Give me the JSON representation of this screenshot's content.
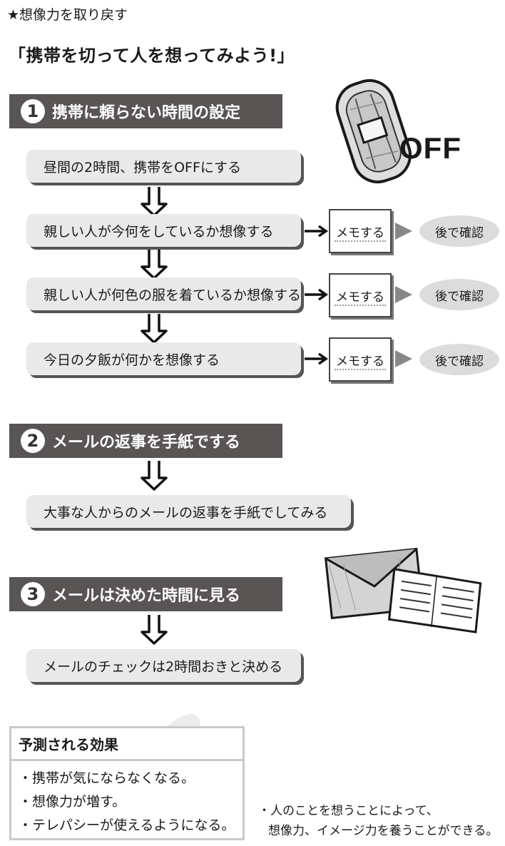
{
  "header": "★想像力を取り戻す",
  "title": "「携帯を切って人を想ってみよう!」",
  "phone_off_label": "OFF",
  "sections": [
    {
      "number": "1",
      "label": "携帯に頼らない時間の設定"
    },
    {
      "number": "2",
      "label": "メールの返事を手紙でする"
    },
    {
      "number": "3",
      "label": "メールは決めた時間に見る"
    }
  ],
  "steps": [
    "昼間の2時間、携帯をOFFにする",
    "親しい人が今何をしているか想像する",
    "親しい人が何色の服を着ているか想像する",
    "今日の夕飯が何かを想像する",
    "大事な人からのメールの返事を手紙でしてみる",
    "メールのチェックは2時間おきと決める"
  ],
  "memo_label": "メモする",
  "confirm_label": "後で確認",
  "effects": {
    "title": "予測される効果",
    "items": [
      "・携帯が気にならなくなる。",
      "・想像力が増す。",
      "・テレパシーが使えるようになる。"
    ]
  },
  "note": {
    "line1": "・人のことを想うことによって、",
    "line2": "想像力、イメージ力を養うことができる。"
  }
}
